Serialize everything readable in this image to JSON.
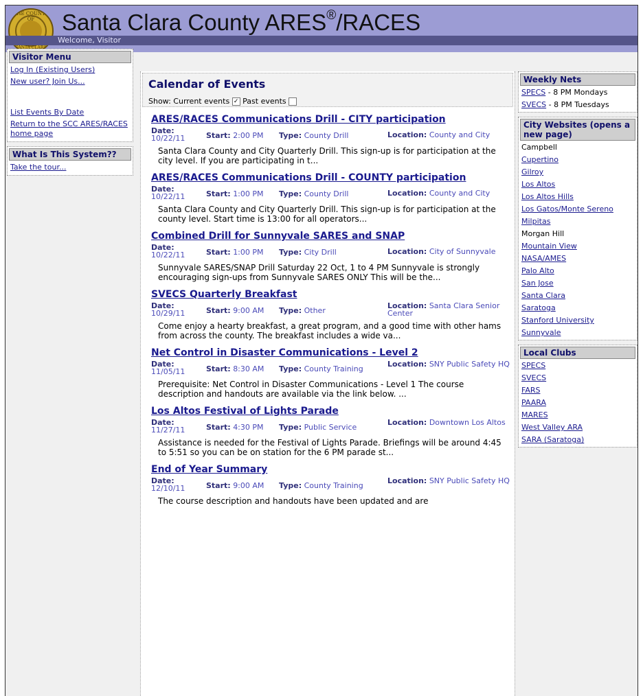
{
  "header": {
    "title": "Santa Clara County ARES",
    "registered": "®",
    "title_suffix": "/RACES",
    "welcome": "Welcome, Visitor",
    "seal_top": "THE COUNTY OF",
    "seal_bottom": "SANTA CLARA"
  },
  "visitor_menu": {
    "title": "Visitor Menu",
    "login": "Log In (Existing Users)",
    "join": "New user? Join Us...",
    "list_events": "List Events By Date",
    "return_home": "Return to the SCC ARES/RACES home page"
  },
  "about_box": {
    "title": "What Is This System??",
    "tour": "Take the tour..."
  },
  "calendar": {
    "title": "Calendar of Events",
    "show_label": "Show:",
    "current_label": "Current events",
    "current_checked": true,
    "past_label": "Past events",
    "past_checked": false
  },
  "labels": {
    "date": "Date:",
    "start": "Start:",
    "type": "Type:",
    "location": "Location:"
  },
  "events": [
    {
      "title": "ARES/RACES Communications Drill - CITY participation",
      "date": "10/22/11",
      "start": "2:00 PM",
      "type": "County Drill",
      "location": "County and City",
      "description": "Santa Clara County and City Quarterly Drill.  This sign-up is for participation at the city level.  If you are participating in t..."
    },
    {
      "title": "ARES/RACES Communications Drill - COUNTY participation",
      "date": "10/22/11",
      "start": "1:00 PM",
      "type": "County Drill",
      "location": "County and City",
      "description": "Santa Clara County and City Quarterly Drill.  This sign-up is for participation at the county level. Start time is 13:00 for all operators..."
    },
    {
      "title": "Combined Drill for Sunnyvale SARES and SNAP",
      "date": "10/22/11",
      "start": "1:00 PM",
      "type": "City Drill",
      "location": "City of Sunnyvale",
      "description": "Sunnyvale SARES/SNAP Drill Saturday 22 Oct, 1 to 4 PM Sunnyvale is strongly encouraging sign-ups from Sunnyvale SARES ONLY This will be the..."
    },
    {
      "title": "SVECS Quarterly Breakfast",
      "date": "10/29/11",
      "start": "9:00 AM",
      "type": "Other",
      "location": "Santa Clara Senior Center",
      "description": "Come enjoy a hearty breakfast, a great program, and a good time with other hams from across the county.  The breakfast includes a wide va..."
    },
    {
      "title": "Net Control in Disaster Communications - Level 2",
      "date": "11/05/11",
      "start": "8:30 AM",
      "type": "County Training",
      "location": "SNY Public Safety HQ",
      "description": "Prerequisite:  Net Control in Disaster Communications - Level 1 The course description and handouts are available via the link below. ..."
    },
    {
      "title": "Los Altos Festival of Lights Parade",
      "date": "11/27/11",
      "start": "4:30 PM",
      "type": "Public Service",
      "location": "Downtown Los Altos",
      "description": "Assistance is needed for the Festival of Lights Parade.  Briefings will be around 4:45 to 5:51 so you can be on station for the 6 PM parade st..."
    },
    {
      "title": "End of Year Summary",
      "date": "12/10/11",
      "start": "9:00 AM",
      "type": "County Training",
      "location": "SNY Public Safety HQ",
      "description": "The course description and handouts have been updated and are"
    }
  ],
  "weekly_nets": {
    "title": "Weekly Nets",
    "items": [
      {
        "link": "SPECS",
        "text": " - 8 PM Mondays"
      },
      {
        "link": "SVECS",
        "text": " - 8 PM Tuesdays"
      }
    ]
  },
  "city_websites": {
    "title": "City Websites (opens a new page)",
    "items": [
      {
        "label": "Campbell",
        "link": false
      },
      {
        "label": "Cupertino",
        "link": true
      },
      {
        "label": "Gilroy",
        "link": true
      },
      {
        "label": "Los Altos",
        "link": true
      },
      {
        "label": "Los Altos Hills",
        "link": true
      },
      {
        "label": "Los Gatos/Monte Sereno",
        "link": true
      },
      {
        "label": "Milpitas",
        "link": true
      },
      {
        "label": "Morgan Hill",
        "link": false
      },
      {
        "label": "Mountain View",
        "link": true
      },
      {
        "label": "NASA/AMES",
        "link": true
      },
      {
        "label": "Palo Alto",
        "link": true
      },
      {
        "label": "San Jose",
        "link": true
      },
      {
        "label": "Santa Clara",
        "link": true
      },
      {
        "label": "Saratoga",
        "link": true
      },
      {
        "label": "Stanford University",
        "link": true
      },
      {
        "label": "Sunnyvale",
        "link": true
      }
    ]
  },
  "local_clubs": {
    "title": "Local Clubs",
    "items": [
      "SPECS",
      "SVECS",
      "FARS",
      "PAARA",
      "MARES",
      "West Valley ARA",
      "SARA (Saratoga)"
    ]
  }
}
